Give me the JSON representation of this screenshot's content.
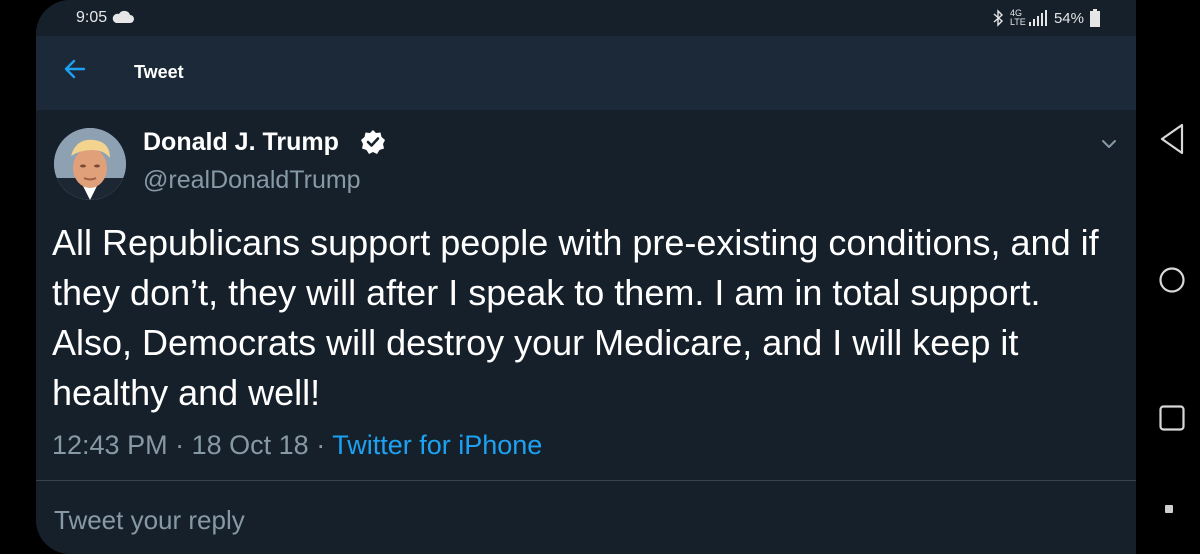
{
  "status_bar": {
    "time": "9:05",
    "weather_icon": "cloud-icon",
    "network_type": "4G LTE",
    "battery": "54%"
  },
  "header": {
    "back_icon": "arrow-left-icon",
    "title": "Tweet"
  },
  "tweet": {
    "author_name": "Donald J. Trump",
    "handle": "@realDonaldTrump",
    "verified": true,
    "text": "All Republicans support people with pre-existing conditions, and if they don’t, they will after I speak to them. I am in total support. Also, Democrats will destroy your Medicare, and I will keep it healthy and well!",
    "time": "12:43 PM",
    "date": "18 Oct 18",
    "separator": "·",
    "source": "Twitter for iPhone"
  },
  "reply": {
    "placeholder": "Tweet your reply"
  },
  "colors": {
    "background": "#15202b",
    "header": "#1c2938",
    "accent": "#1da1f2",
    "secondary_text": "#8899a6"
  }
}
